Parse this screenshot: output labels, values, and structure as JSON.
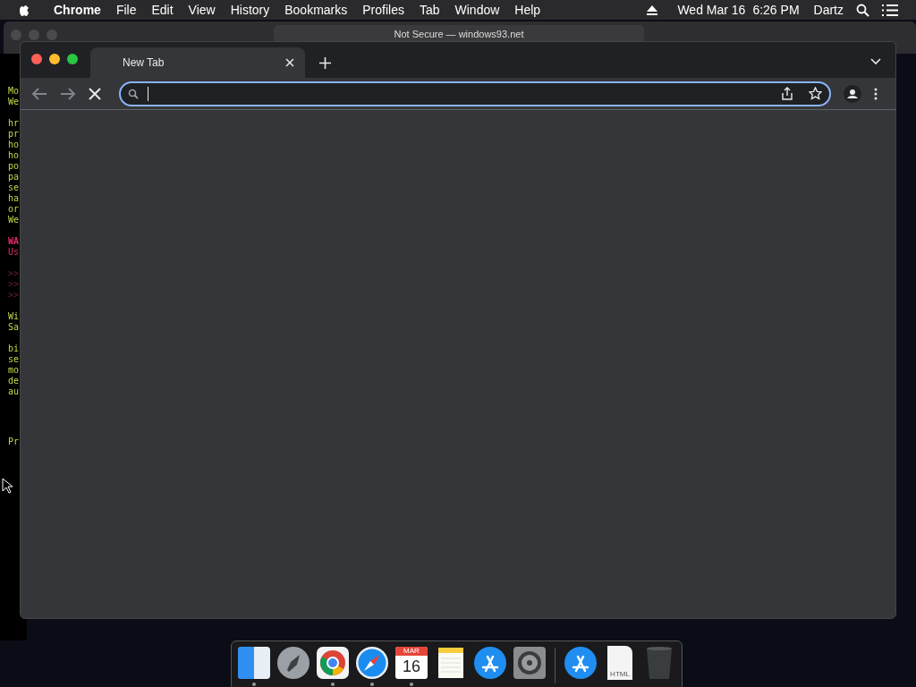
{
  "menu_bar": {
    "app": "Chrome",
    "items": [
      "File",
      "Edit",
      "View",
      "History",
      "Bookmarks",
      "Profiles",
      "Tab",
      "Window",
      "Help"
    ],
    "date": "Wed Mar 16",
    "time": "6:26 PM",
    "user": "Dartz"
  },
  "background_window": {
    "address": "Not Secure — windows93.net"
  },
  "terminal": {
    "blocks": [
      {
        "kind": "normal",
        "lines": [
          "Mo",
          "We"
        ]
      },
      {
        "kind": "normal",
        "lines": [
          "hr",
          "pr",
          "ho",
          "ho",
          "po",
          "pa",
          "se",
          "ha",
          "or",
          "We"
        ]
      },
      {
        "kind": "warning",
        "lines": [
          "WA",
          "Us"
        ]
      },
      {
        "kind": "prompt",
        "lines": [
          ">>",
          ">>",
          ">>"
        ]
      },
      {
        "kind": "normal",
        "lines": [
          "Wi",
          "Sa"
        ]
      },
      {
        "kind": "normal",
        "lines": [
          "bi",
          "se",
          "mo",
          "de",
          "au"
        ]
      },
      {
        "kind": "normal",
        "lines": [
          "Pr"
        ]
      }
    ]
  },
  "browser": {
    "tabs": [
      {
        "title": "New Tab",
        "selected": true
      }
    ],
    "loading": true
  },
  "dock": {
    "items": [
      {
        "kind": "finder",
        "running": true
      },
      {
        "kind": "launchpad",
        "running": false
      },
      {
        "kind": "chrome",
        "running": true
      },
      {
        "kind": "safari",
        "running": true
      },
      {
        "kind": "calendar",
        "running": true,
        "month": "MAR",
        "day": "16"
      },
      {
        "kind": "notes",
        "running": false
      },
      {
        "kind": "appstore",
        "running": false
      },
      {
        "kind": "settings",
        "running": false
      },
      {
        "kind": "separator"
      },
      {
        "kind": "appstore",
        "running": false
      },
      {
        "kind": "file",
        "running": false,
        "label": "HTML"
      },
      {
        "kind": "trash",
        "running": false
      }
    ]
  }
}
